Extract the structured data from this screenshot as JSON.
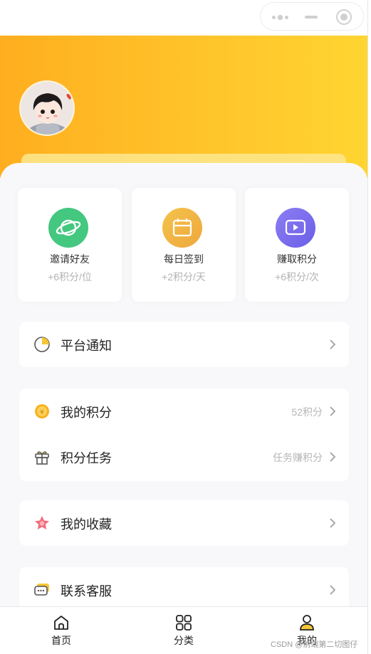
{
  "capsule": {
    "more_icon": "more-dots-icon",
    "minimize_icon": "minus-icon",
    "close_icon": "target-icon"
  },
  "header": {
    "avatar_icon": "cartoon-avatar",
    "colors": {
      "start": "#ffae1f",
      "end": "#ffd531"
    }
  },
  "stats": [
    {
      "title": "邀请好友",
      "sub": "+6积分/位",
      "icon": "planet-icon",
      "color": "#44c77f"
    },
    {
      "title": "每日签到",
      "sub": "+2积分/天",
      "icon": "calendar-icon",
      "color": "#f2b843"
    },
    {
      "title": "赚取积分",
      "sub": "+6积分/次",
      "icon": "video-play-icon",
      "color": "#7b6cf0"
    }
  ],
  "menu": {
    "notice": {
      "label": "平台通知",
      "icon": "pie-chart-icon"
    },
    "points": {
      "label": "我的积分",
      "value": "52积分",
      "icon": "coin-icon"
    },
    "tasks": {
      "label": "积分任务",
      "value": "任务赚积分",
      "icon": "gift-icon"
    },
    "favorites": {
      "label": "我的收藏",
      "icon": "star-icon"
    },
    "service": {
      "label": "联系客服",
      "icon": "chat-icon"
    }
  },
  "tabbar": [
    {
      "label": "首页",
      "icon": "home-icon"
    },
    {
      "label": "分类",
      "icon": "grid-icon"
    },
    {
      "label": "我的",
      "icon": "user-icon"
    }
  ],
  "watermark": "CSDN @前端第二切图仔"
}
